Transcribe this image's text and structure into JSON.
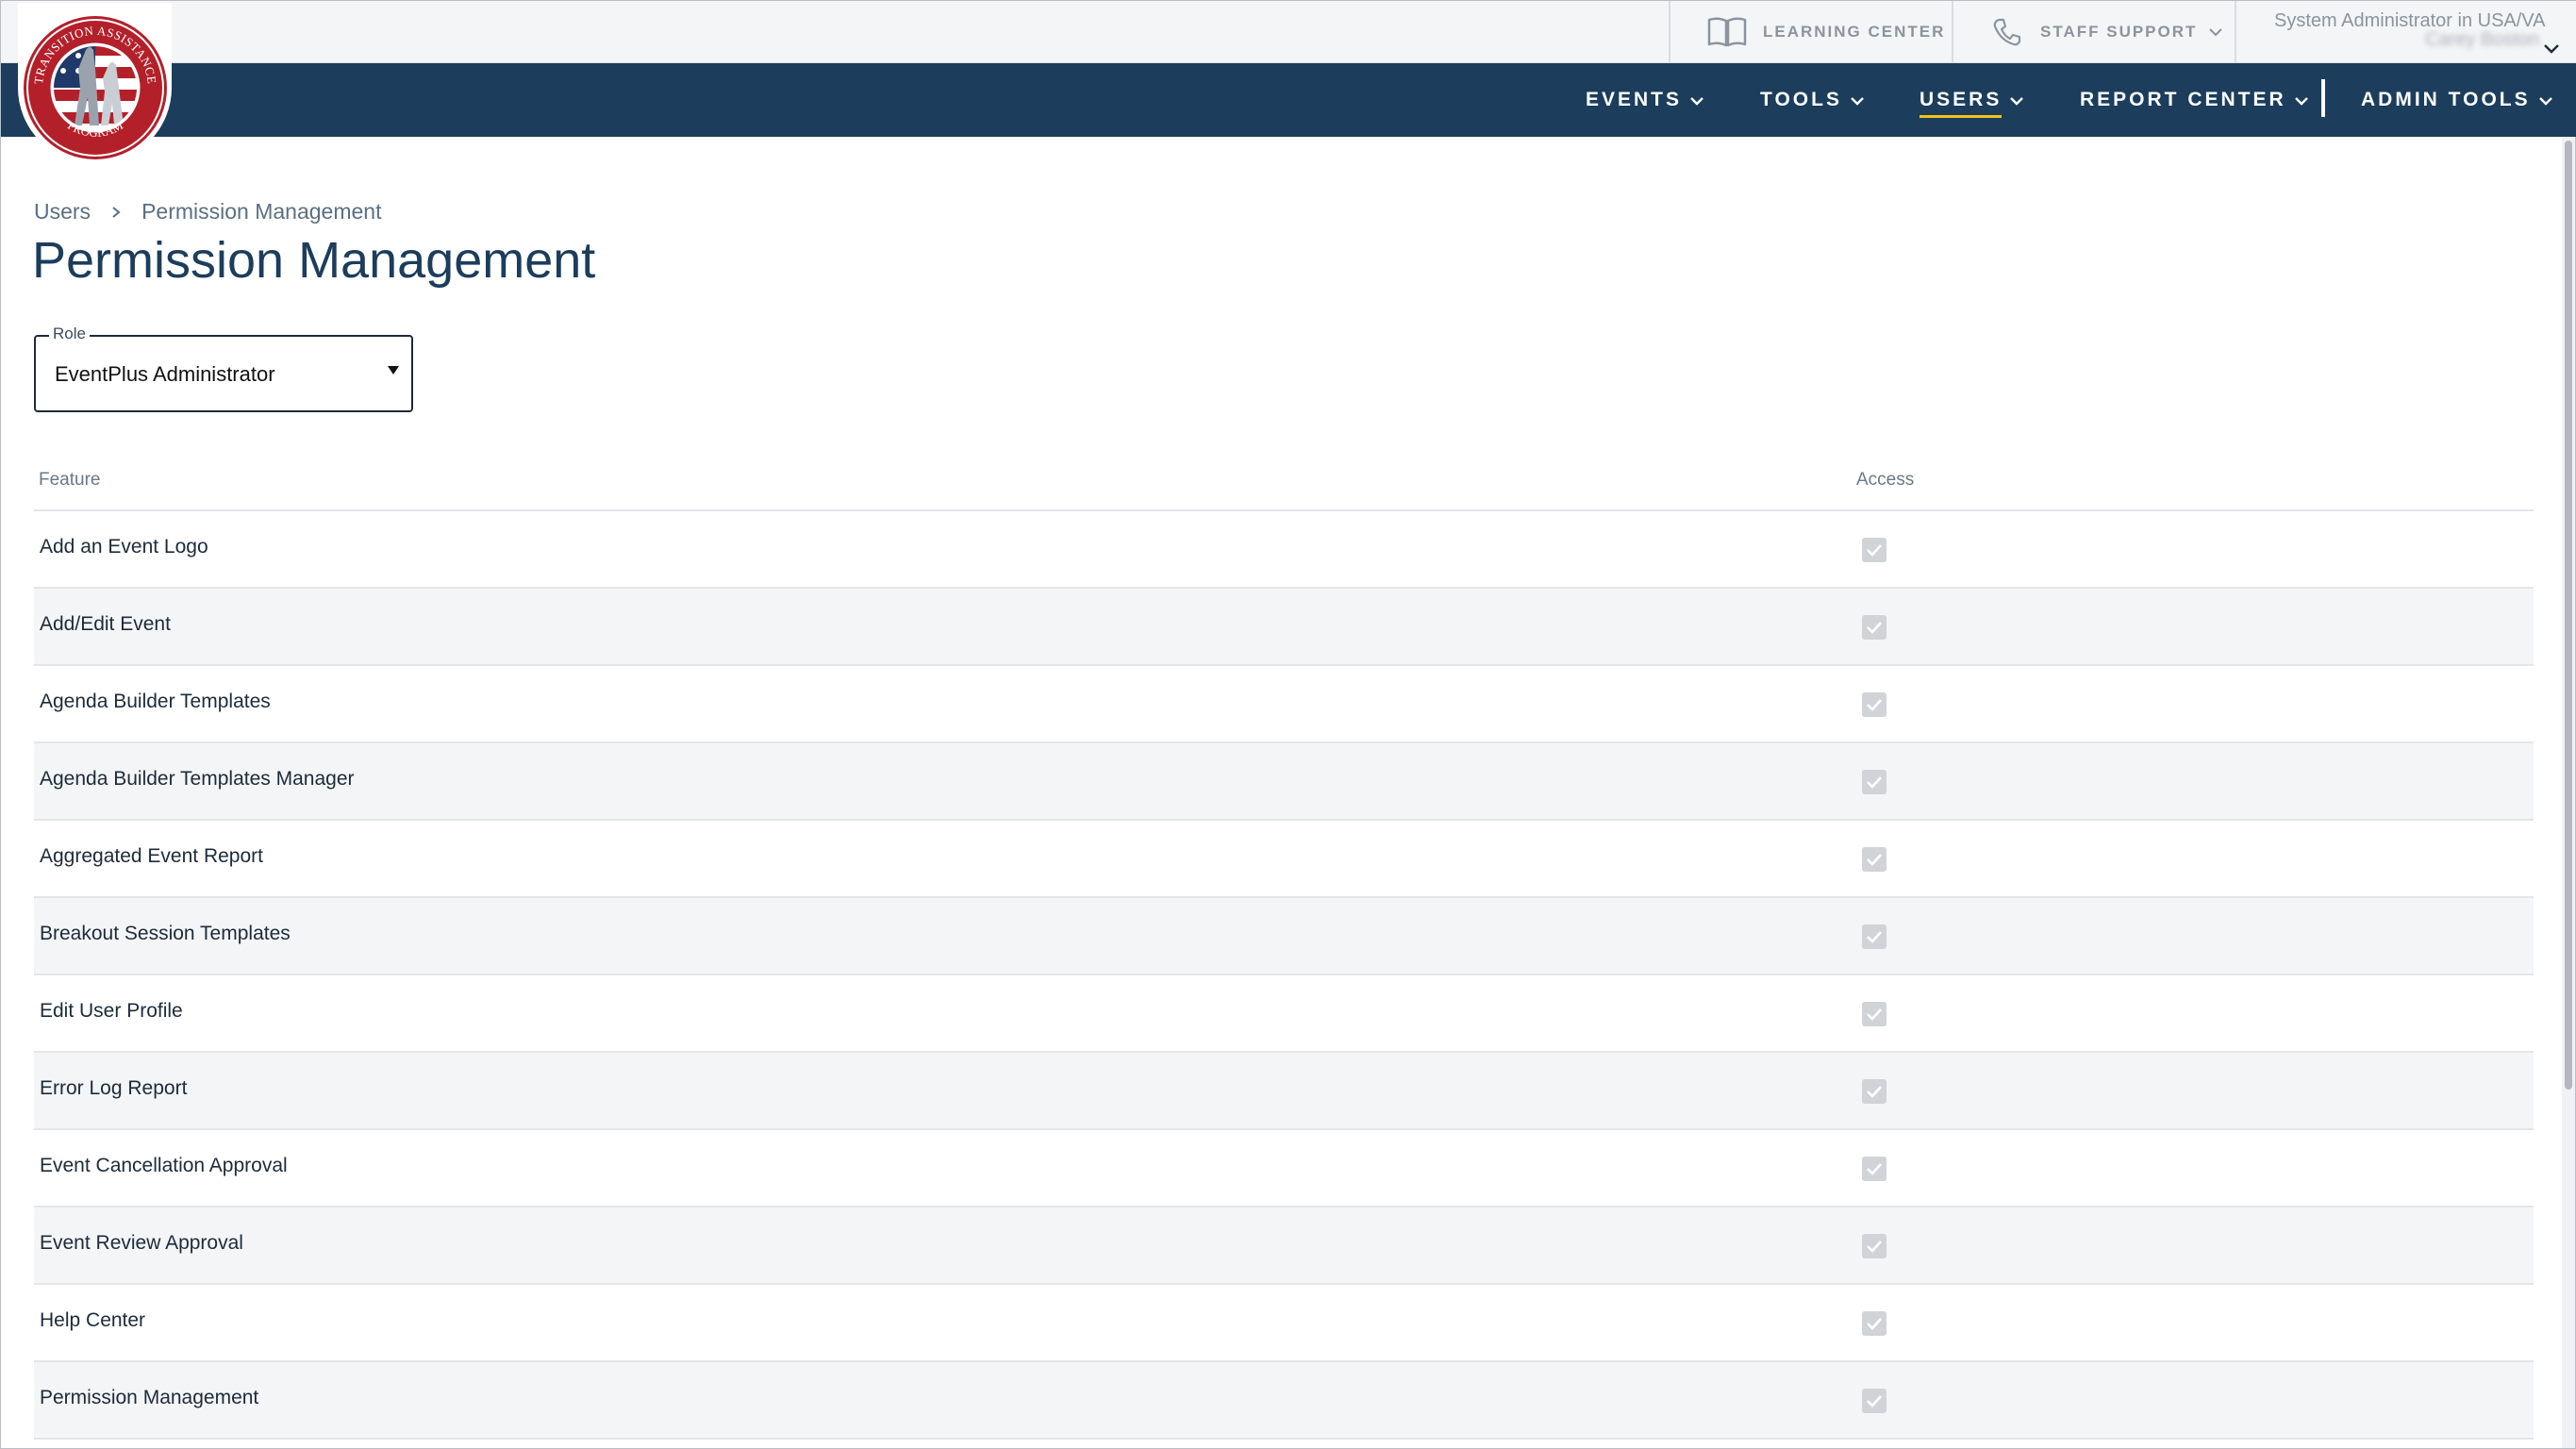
{
  "logo": {
    "top_text": "TRANSITION ASSISTANCE",
    "bottom_text": "PROGRAM"
  },
  "util": {
    "learning_center": "LEARNING CENTER",
    "staff_support": "STAFF SUPPORT",
    "user_role": "System Administrator in USA/VA",
    "user_name": "Carey Boston"
  },
  "nav": {
    "items": [
      {
        "label": "EVENTS"
      },
      {
        "label": "TOOLS"
      },
      {
        "label": "USERS",
        "active": true
      },
      {
        "label": "REPORT CENTER"
      },
      {
        "label": "ADMIN TOOLS"
      }
    ]
  },
  "breadcrumb": {
    "root": "Users",
    "current": "Permission Management"
  },
  "page_title": "Permission Management",
  "role_select": {
    "label": "Role",
    "value": "EventPlus Administrator"
  },
  "table": {
    "col_feature": "Feature",
    "col_access": "Access",
    "rows": [
      {
        "feature": "Add an Event Logo",
        "access": true
      },
      {
        "feature": "Add/Edit Event",
        "access": true
      },
      {
        "feature": "Agenda Builder Templates",
        "access": true
      },
      {
        "feature": "Agenda Builder Templates Manager",
        "access": true
      },
      {
        "feature": "Aggregated Event Report",
        "access": true
      },
      {
        "feature": "Breakout Session Templates",
        "access": true
      },
      {
        "feature": "Edit User Profile",
        "access": true
      },
      {
        "feature": "Error Log Report",
        "access": true
      },
      {
        "feature": "Event Cancellation Approval",
        "access": true
      },
      {
        "feature": "Event Review Approval",
        "access": true
      },
      {
        "feature": "Help Center",
        "access": true
      },
      {
        "feature": "Permission Management",
        "access": true
      }
    ]
  },
  "colors": {
    "nav_bg": "#1c3d5c",
    "active_underline": "#f2c21b",
    "checkbox_disabled": "#d0d3d7"
  }
}
